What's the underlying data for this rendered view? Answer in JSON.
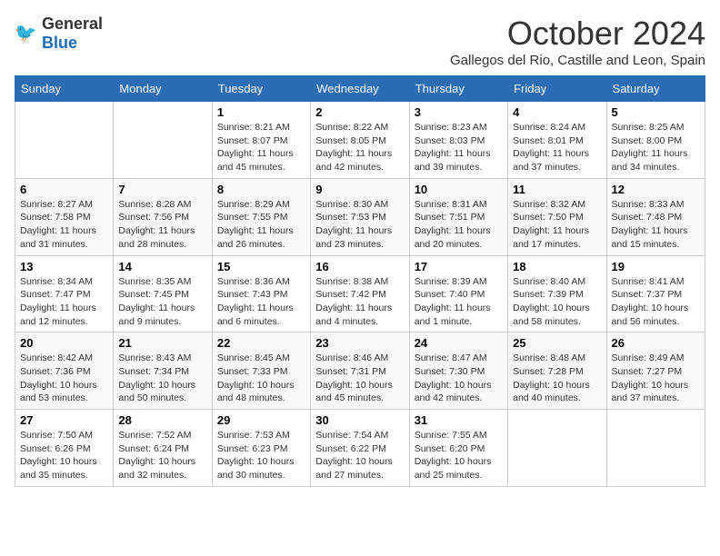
{
  "header": {
    "logo_general": "General",
    "logo_blue": "Blue",
    "month_title": "October 2024",
    "subtitle": "Gallegos del Rio, Castille and Leon, Spain"
  },
  "weekdays": [
    "Sunday",
    "Monday",
    "Tuesday",
    "Wednesday",
    "Thursday",
    "Friday",
    "Saturday"
  ],
  "weeks": [
    [
      {
        "day": "",
        "sunrise": "",
        "sunset": "",
        "daylight": ""
      },
      {
        "day": "",
        "sunrise": "",
        "sunset": "",
        "daylight": ""
      },
      {
        "day": "1",
        "sunrise": "Sunrise: 8:21 AM",
        "sunset": "Sunset: 8:07 PM",
        "daylight": "Daylight: 11 hours and 45 minutes."
      },
      {
        "day": "2",
        "sunrise": "Sunrise: 8:22 AM",
        "sunset": "Sunset: 8:05 PM",
        "daylight": "Daylight: 11 hours and 42 minutes."
      },
      {
        "day": "3",
        "sunrise": "Sunrise: 8:23 AM",
        "sunset": "Sunset: 8:03 PM",
        "daylight": "Daylight: 11 hours and 39 minutes."
      },
      {
        "day": "4",
        "sunrise": "Sunrise: 8:24 AM",
        "sunset": "Sunset: 8:01 PM",
        "daylight": "Daylight: 11 hours and 37 minutes."
      },
      {
        "day": "5",
        "sunrise": "Sunrise: 8:25 AM",
        "sunset": "Sunset: 8:00 PM",
        "daylight": "Daylight: 11 hours and 34 minutes."
      }
    ],
    [
      {
        "day": "6",
        "sunrise": "Sunrise: 8:27 AM",
        "sunset": "Sunset: 7:58 PM",
        "daylight": "Daylight: 11 hours and 31 minutes."
      },
      {
        "day": "7",
        "sunrise": "Sunrise: 8:28 AM",
        "sunset": "Sunset: 7:56 PM",
        "daylight": "Daylight: 11 hours and 28 minutes."
      },
      {
        "day": "8",
        "sunrise": "Sunrise: 8:29 AM",
        "sunset": "Sunset: 7:55 PM",
        "daylight": "Daylight: 11 hours and 26 minutes."
      },
      {
        "day": "9",
        "sunrise": "Sunrise: 8:30 AM",
        "sunset": "Sunset: 7:53 PM",
        "daylight": "Daylight: 11 hours and 23 minutes."
      },
      {
        "day": "10",
        "sunrise": "Sunrise: 8:31 AM",
        "sunset": "Sunset: 7:51 PM",
        "daylight": "Daylight: 11 hours and 20 minutes."
      },
      {
        "day": "11",
        "sunrise": "Sunrise: 8:32 AM",
        "sunset": "Sunset: 7:50 PM",
        "daylight": "Daylight: 11 hours and 17 minutes."
      },
      {
        "day": "12",
        "sunrise": "Sunrise: 8:33 AM",
        "sunset": "Sunset: 7:48 PM",
        "daylight": "Daylight: 11 hours and 15 minutes."
      }
    ],
    [
      {
        "day": "13",
        "sunrise": "Sunrise: 8:34 AM",
        "sunset": "Sunset: 7:47 PM",
        "daylight": "Daylight: 11 hours and 12 minutes."
      },
      {
        "day": "14",
        "sunrise": "Sunrise: 8:35 AM",
        "sunset": "Sunset: 7:45 PM",
        "daylight": "Daylight: 11 hours and 9 minutes."
      },
      {
        "day": "15",
        "sunrise": "Sunrise: 8:36 AM",
        "sunset": "Sunset: 7:43 PM",
        "daylight": "Daylight: 11 hours and 6 minutes."
      },
      {
        "day": "16",
        "sunrise": "Sunrise: 8:38 AM",
        "sunset": "Sunset: 7:42 PM",
        "daylight": "Daylight: 11 hours and 4 minutes."
      },
      {
        "day": "17",
        "sunrise": "Sunrise: 8:39 AM",
        "sunset": "Sunset: 7:40 PM",
        "daylight": "Daylight: 11 hours and 1 minute."
      },
      {
        "day": "18",
        "sunrise": "Sunrise: 8:40 AM",
        "sunset": "Sunset: 7:39 PM",
        "daylight": "Daylight: 10 hours and 58 minutes."
      },
      {
        "day": "19",
        "sunrise": "Sunrise: 8:41 AM",
        "sunset": "Sunset: 7:37 PM",
        "daylight": "Daylight: 10 hours and 56 minutes."
      }
    ],
    [
      {
        "day": "20",
        "sunrise": "Sunrise: 8:42 AM",
        "sunset": "Sunset: 7:36 PM",
        "daylight": "Daylight: 10 hours and 53 minutes."
      },
      {
        "day": "21",
        "sunrise": "Sunrise: 8:43 AM",
        "sunset": "Sunset: 7:34 PM",
        "daylight": "Daylight: 10 hours and 50 minutes."
      },
      {
        "day": "22",
        "sunrise": "Sunrise: 8:45 AM",
        "sunset": "Sunset: 7:33 PM",
        "daylight": "Daylight: 10 hours and 48 minutes."
      },
      {
        "day": "23",
        "sunrise": "Sunrise: 8:46 AM",
        "sunset": "Sunset: 7:31 PM",
        "daylight": "Daylight: 10 hours and 45 minutes."
      },
      {
        "day": "24",
        "sunrise": "Sunrise: 8:47 AM",
        "sunset": "Sunset: 7:30 PM",
        "daylight": "Daylight: 10 hours and 42 minutes."
      },
      {
        "day": "25",
        "sunrise": "Sunrise: 8:48 AM",
        "sunset": "Sunset: 7:28 PM",
        "daylight": "Daylight: 10 hours and 40 minutes."
      },
      {
        "day": "26",
        "sunrise": "Sunrise: 8:49 AM",
        "sunset": "Sunset: 7:27 PM",
        "daylight": "Daylight: 10 hours and 37 minutes."
      }
    ],
    [
      {
        "day": "27",
        "sunrise": "Sunrise: 7:50 AM",
        "sunset": "Sunset: 6:26 PM",
        "daylight": "Daylight: 10 hours and 35 minutes."
      },
      {
        "day": "28",
        "sunrise": "Sunrise: 7:52 AM",
        "sunset": "Sunset: 6:24 PM",
        "daylight": "Daylight: 10 hours and 32 minutes."
      },
      {
        "day": "29",
        "sunrise": "Sunrise: 7:53 AM",
        "sunset": "Sunset: 6:23 PM",
        "daylight": "Daylight: 10 hours and 30 minutes."
      },
      {
        "day": "30",
        "sunrise": "Sunrise: 7:54 AM",
        "sunset": "Sunset: 6:22 PM",
        "daylight": "Daylight: 10 hours and 27 minutes."
      },
      {
        "day": "31",
        "sunrise": "Sunrise: 7:55 AM",
        "sunset": "Sunset: 6:20 PM",
        "daylight": "Daylight: 10 hours and 25 minutes."
      },
      {
        "day": "",
        "sunrise": "",
        "sunset": "",
        "daylight": ""
      },
      {
        "day": "",
        "sunrise": "",
        "sunset": "",
        "daylight": ""
      }
    ]
  ]
}
